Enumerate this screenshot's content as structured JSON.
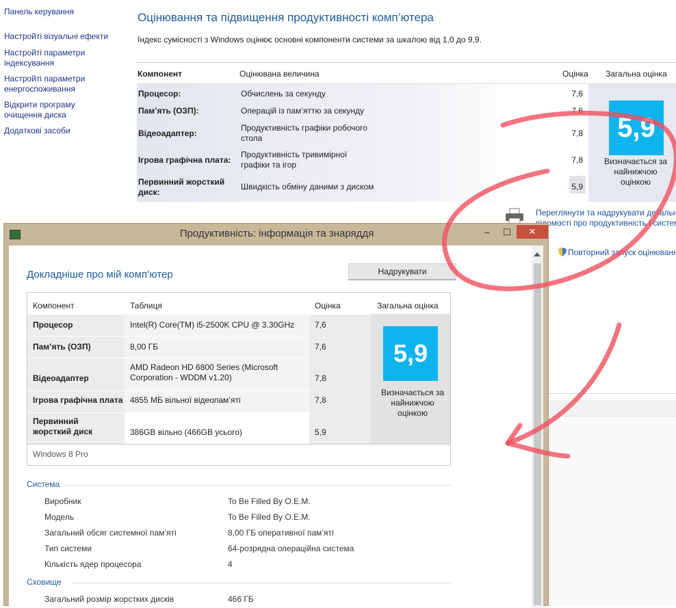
{
  "nav": {
    "home": "Панель керування",
    "items": [
      "Настройті візуальні ефекти",
      "Настройті параметри індексування",
      "Настройті параметри енергоспоживання",
      "Відкрити програму очищення диска",
      "Додаткові засоби"
    ]
  },
  "main": {
    "title": "Оцінювання та підвищення продуктивності комп’ютера",
    "description": "Індекс сумісності з Windows оцінює основні компоненти системи за шкалою від 1,0 до 9,9.",
    "headers": {
      "component": "Компонент",
      "measured": "Оцінювана величина",
      "score": "Оцінка",
      "base": "Загальна оцінка"
    },
    "rows": [
      {
        "component": "Процесор:",
        "measured": "Обчислень за секунду",
        "score": "7,6"
      },
      {
        "component": "Пам’ять (ОЗП):",
        "measured": "Операцій із пам’яттю за секунду",
        "score": "7,6"
      },
      {
        "component": "Відеоадаптер:",
        "measured": "Продуктивність графіки робочого стола",
        "score": "7,8"
      },
      {
        "component": "Ігрова графічна плата:",
        "measured": "Продуктивність тривимірної графіки та ігор",
        "score": "7,8"
      },
      {
        "component": "Первинний жорсткий диск:",
        "measured": "Швидкість обміну даними з диском",
        "score": "5,9"
      }
    ],
    "base_score": "5,9",
    "base_caption": "Визначається за найнижчою оцінкою",
    "link_print": "Переглянути та надрукувати детальні відомості про продуктивність і систему",
    "link_rerun": "Повторний запуск оцінювання"
  },
  "dialog": {
    "title": "Продуктивність: інформація та знаряддя",
    "controls": {
      "min": "–",
      "max": "☐",
      "close": "✕"
    },
    "heading": "Докладніше про мій комп’ютер",
    "print_label": "Надрукувати",
    "headers": {
      "component": "Компонент",
      "table": "Таблиця",
      "score": "Оцінка",
      "base": "Загальна оцінка"
    },
    "rows": [
      {
        "component": "Процесор",
        "detail": "Intel(R) Core(TM) i5-2500K CPU @ 3.30GHz",
        "score": "7,6"
      },
      {
        "component": "Пам’ять (ОЗП)",
        "detail": "8,00 ГБ",
        "score": "7,6"
      },
      {
        "component": "Відеоадаптер",
        "detail": "AMD Radeon HD 6800 Series (Microsoft Corporation - WDDM v1.20)",
        "score": "7,8"
      },
      {
        "component": "Ігрова графічна плата",
        "detail": "4855 МБ вільної відеопам’яті",
        "score": "7,8"
      },
      {
        "component": "Первинний жорсткий диск",
        "detail": "386GB вільно (466GB усього)",
        "score": "5,9"
      }
    ],
    "base_score": "5,9",
    "base_caption": "Визначається за найнижчою оцінкою",
    "os": "Windows 8 Pro",
    "system_title": "Система",
    "system": [
      {
        "k": "Виробник",
        "v": "To Be Filled By O.E.M."
      },
      {
        "k": "Модель",
        "v": "To Be Filled By O.E.M."
      },
      {
        "k": "Загальний обсяг системної пам’яті",
        "v": "8,00 ГБ оперативної пам’яті"
      },
      {
        "k": "Тип системи",
        "v": "64-розрядна операційна система"
      },
      {
        "k": "Кількість ядер процесора",
        "v": "4"
      }
    ],
    "storage_title": "Сховище",
    "storage": [
      {
        "k": "Загальний розмір жорстких дисків",
        "v": "466 ГБ"
      }
    ]
  },
  "colors": {
    "accent": "#0FB4EF",
    "link": "#1E50A0",
    "annotation": "#F0505F"
  }
}
